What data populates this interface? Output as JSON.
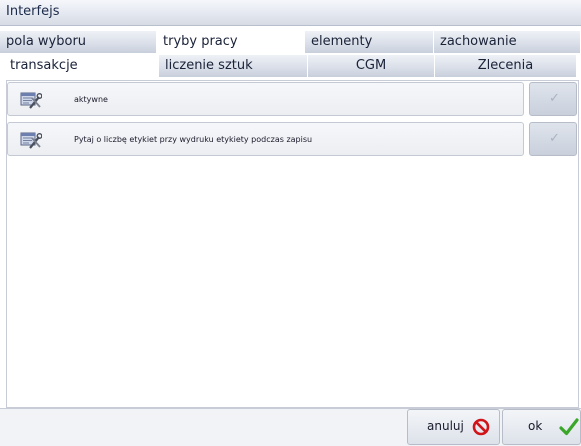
{
  "window": {
    "title": "Interfejs"
  },
  "tabs_top": [
    {
      "label": "pola wyboru",
      "active": false
    },
    {
      "label": "tryby pracy",
      "active": true
    },
    {
      "label": "elementy",
      "active": false
    },
    {
      "label": "zachowanie",
      "active": false
    }
  ],
  "tabs_sub": [
    {
      "label": "transakcje",
      "active": true
    },
    {
      "label": "liczenie sztuk",
      "active": false
    },
    {
      "label": "CGM",
      "active": false
    },
    {
      "label": "Zlecenia",
      "active": false
    }
  ],
  "options": [
    {
      "label": "aktywne",
      "icon": "settings-tools-icon",
      "checked": false
    },
    {
      "label": "Pytaj o liczbę etykiet przy wydruku etykiety podczas zapisu",
      "icon": "settings-tools-icon",
      "checked": false
    }
  ],
  "footer": {
    "cancel_label": "anuluj",
    "ok_label": "ok"
  },
  "icons": {
    "cancel": "prohibited-icon",
    "ok": "checkmark-icon",
    "option_check": "checkmark-icon"
  },
  "colors": {
    "cancel_icon": "#d0141a",
    "ok_icon": "#3aa62a",
    "check_disabled": "#aab3c2"
  }
}
